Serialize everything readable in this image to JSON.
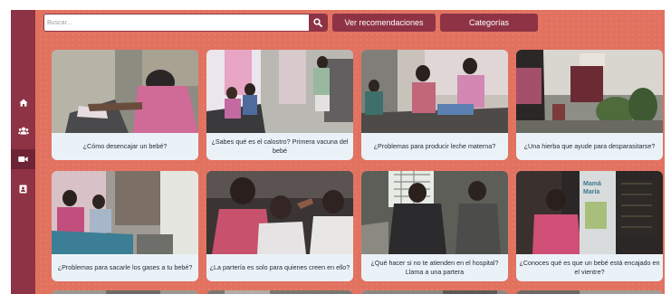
{
  "search": {
    "placeholder": "Buscar..."
  },
  "toolbar": {
    "recommendations_label": "Ver recomendaciones",
    "categories_label": "Categorías"
  },
  "sidebar": {
    "items": [
      {
        "icon": "home-icon"
      },
      {
        "icon": "users-icon"
      },
      {
        "icon": "video-icon",
        "active": true
      },
      {
        "icon": "contact-card-icon"
      }
    ]
  },
  "videos": [
    {
      "title": "¿Cómo desencajar un bebé?"
    },
    {
      "title": "¿Sabes qué es el calostro? Primera vacuna del bebé"
    },
    {
      "title": "¿Problemas para producir leche materna?"
    },
    {
      "title": "¿Una hierba que ayude para desparasitarse?"
    },
    {
      "title": "¿Problemas para sacarle los gases a tu bebé?"
    },
    {
      "title": "¿La partería es solo para quienes creen en ello?"
    },
    {
      "title": "¿Qué hacer si no te atienden en el hospital? Llama a una partera"
    },
    {
      "title": "¿Conoces qué es que un bebé está encajado en el vientre?"
    }
  ],
  "thumbnail_watermark": {
    "line1": "Mamá",
    "line2": "María"
  },
  "colors": {
    "background": "#e27260",
    "sidebar": "#8e3345",
    "button": "#8e3345",
    "card": "#eaf2f7"
  }
}
